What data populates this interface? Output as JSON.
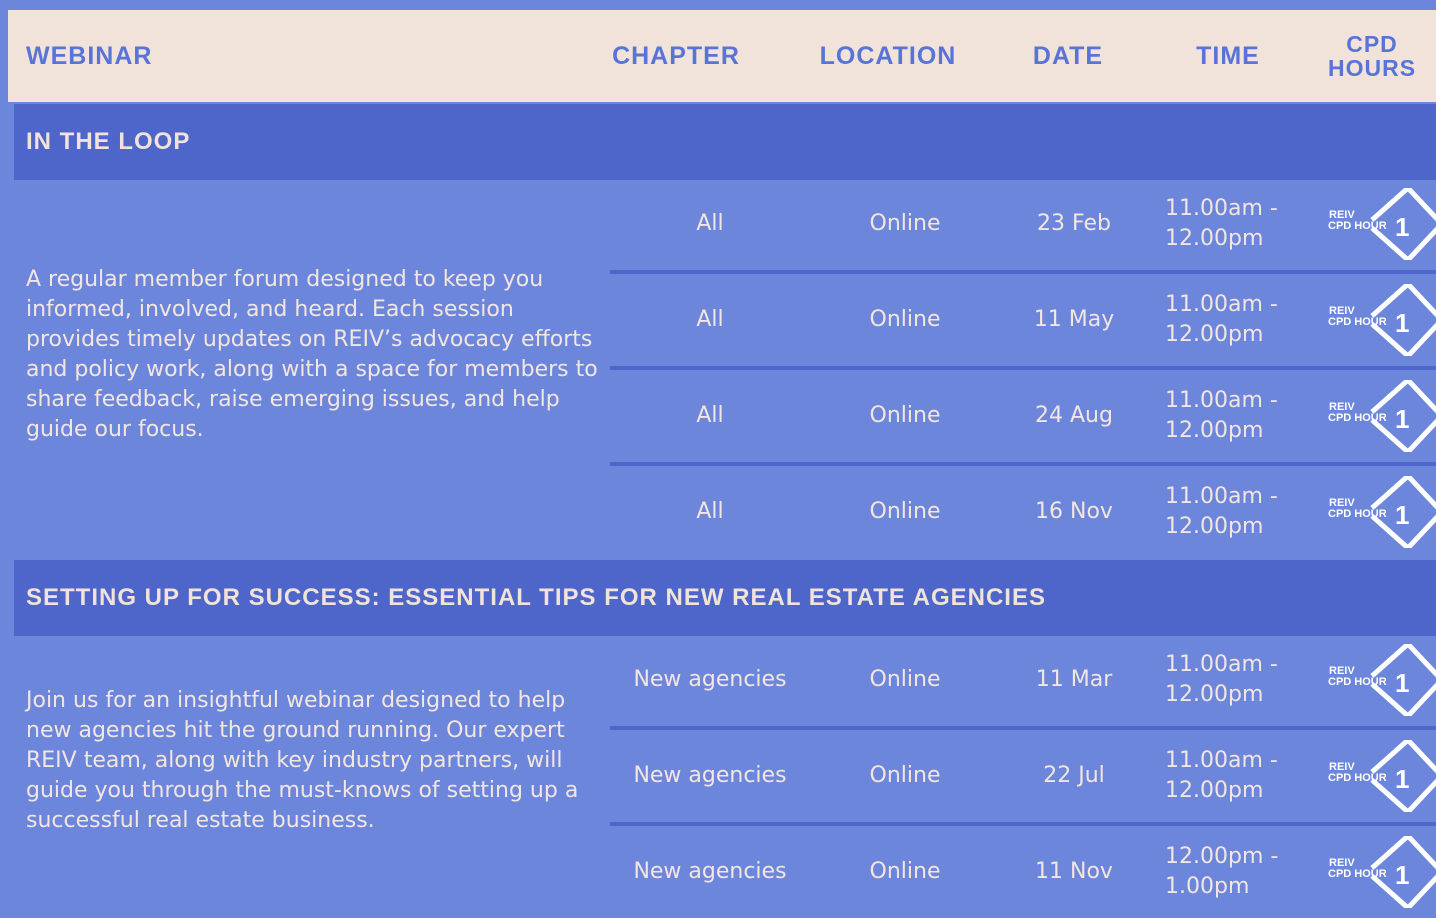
{
  "header": {
    "webinar": "WEBINAR",
    "chapter": "CHAPTER",
    "location": "LOCATION",
    "date": "DATE",
    "time": "TIME",
    "cpd_line1": "CPD",
    "cpd_line2": "HOURS"
  },
  "badge": {
    "line1": "REIV",
    "line2": "CPD HOUR",
    "number": "1"
  },
  "sections": [
    {
      "title": "IN THE LOOP",
      "description": "A regular member forum designed to keep you informed, involved, and heard. Each session provides timely updates on REIV’s advocacy efforts and policy work, along with a space for members to share feedback, raise emerging issues, and help guide our focus.",
      "rows": [
        {
          "chapter": "All",
          "location": "Online",
          "date": "23 Feb",
          "time": "11.00am - 12.00pm"
        },
        {
          "chapter": "All",
          "location": "Online",
          "date": "11 May",
          "time": "11.00am - 12.00pm"
        },
        {
          "chapter": "All",
          "location": "Online",
          "date": "24 Aug",
          "time": "11.00am - 12.00pm"
        },
        {
          "chapter": "All",
          "location": "Online",
          "date": "16 Nov",
          "time": "11.00am - 12.00pm"
        }
      ]
    },
    {
      "title": "SETTING UP FOR SUCCESS: ESSENTIAL TIPS FOR NEW REAL ESTATE AGENCIES",
      "description": "Join us for an insightful webinar designed to help new agencies hit the ground running. Our expert REIV team, along with key industry partners, will guide you through the must-knows of setting up a successful real estate business.",
      "rows": [
        {
          "chapter": "New agencies",
          "location": "Online",
          "date": "11 Mar",
          "time": "11.00am - 12.00pm"
        },
        {
          "chapter": "New agencies",
          "location": "Online",
          "date": "22 Jul",
          "time": "11.00am - 12.00pm"
        },
        {
          "chapter": "New agencies",
          "location": "Online",
          "date": "11 Nov",
          "time": "12.00pm - 1.00pm"
        }
      ]
    }
  ]
}
